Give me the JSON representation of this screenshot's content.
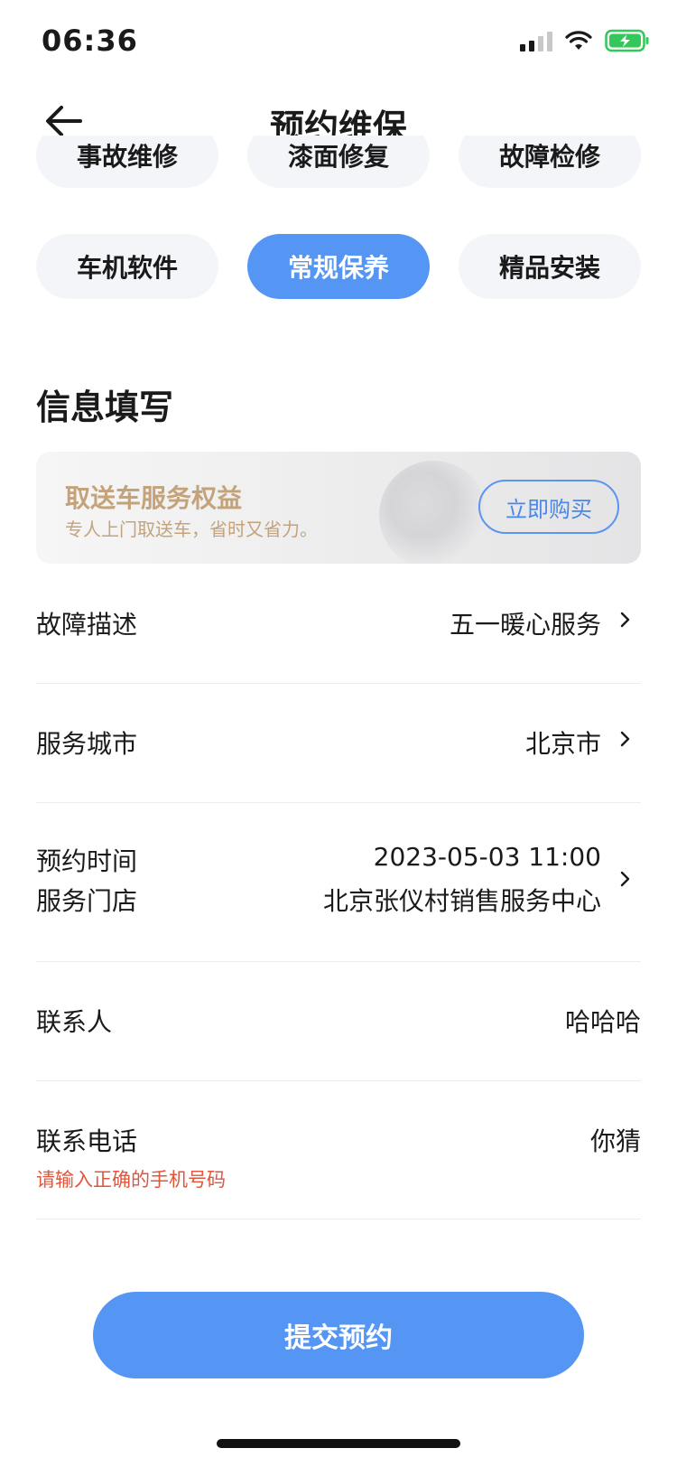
{
  "status_bar": {
    "time": "06:36",
    "icons": [
      "cellular-signal-icon",
      "wifi-icon",
      "battery-charging-icon"
    ],
    "battery_color": "#34c759"
  },
  "nav": {
    "title": "预约维保",
    "back_icon": "back-arrow-icon"
  },
  "service_types": [
    {
      "label": "事故维修",
      "selected": false
    },
    {
      "label": "漆面修复",
      "selected": false
    },
    {
      "label": "故障检修",
      "selected": false
    },
    {
      "label": "车机软件",
      "selected": false
    },
    {
      "label": "常规保养",
      "selected": true
    },
    {
      "label": "精品安装",
      "selected": false
    }
  ],
  "section": {
    "title": "信息填写"
  },
  "promo": {
    "title": "取送车服务权益",
    "subtitle": "专人上门取送车，省时又省力。",
    "button": "立即购买"
  },
  "form": {
    "fault": {
      "label": "故障描述",
      "value": "五一暖心服务"
    },
    "city": {
      "label": "服务城市",
      "value": "北京市"
    },
    "appointment": {
      "time_label": "预约时间",
      "time_value": "2023-05-03 11:00",
      "store_label": "服务门店",
      "store_value": "北京张仪村销售服务中心"
    },
    "contact": {
      "label": "联系人",
      "value": "哈哈哈"
    },
    "phone": {
      "label": "联系电话",
      "value": "你猜",
      "error": "请输入正确的手机号码"
    }
  },
  "submit": {
    "label": "提交预约"
  },
  "colors": {
    "accent": "#5595f3",
    "promo_text": "#c4a37a",
    "error": "#e2553b",
    "chip_bg": "#f3f5f8"
  }
}
